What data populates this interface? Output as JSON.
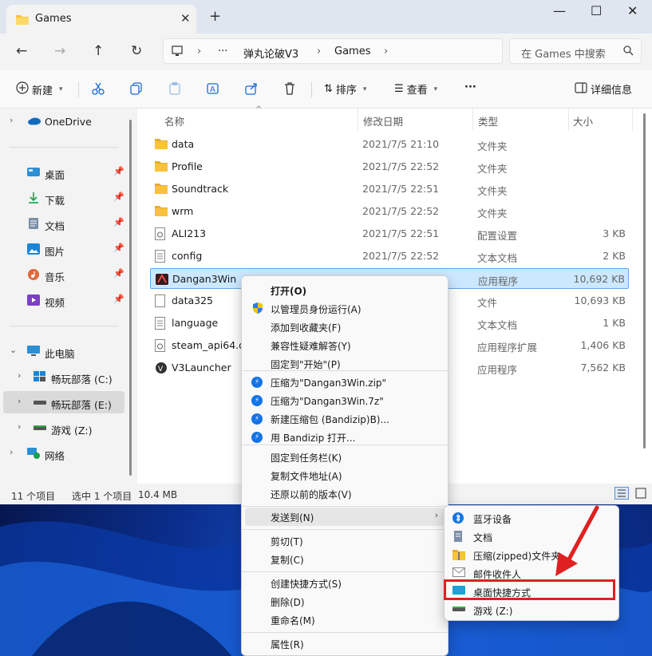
{
  "window": {
    "tab_title": "Games",
    "tab_close": "✕",
    "new_tab": "+",
    "minimize": "—",
    "maximize": "☐",
    "close": "✕"
  },
  "address": {
    "more": "···",
    "crumbs": [
      "弹丸论破V3",
      "Games"
    ],
    "search_placeholder": "在 Games 中搜索"
  },
  "toolbar": {
    "new_label": "新建",
    "sort_label": "排序",
    "view_label": "查看",
    "more_label": "···",
    "details_label": "详细信息"
  },
  "sidebar": {
    "onedrive": "OneDrive",
    "quick": [
      {
        "label": "桌面",
        "icon": "desktop-icon"
      },
      {
        "label": "下载",
        "icon": "download-icon"
      },
      {
        "label": "文档",
        "icon": "document-icon"
      },
      {
        "label": "图片",
        "icon": "pictures-icon"
      },
      {
        "label": "音乐",
        "icon": "music-icon"
      },
      {
        "label": "视频",
        "icon": "video-icon"
      }
    ],
    "this_pc": "此电脑",
    "drives": [
      {
        "label": "畅玩部落 (C:)"
      },
      {
        "label": "畅玩部落 (E:)"
      },
      {
        "label": "游戏 (Z:)"
      }
    ],
    "network": "网络"
  },
  "columns": {
    "name": "名称",
    "date": "修改日期",
    "type": "类型",
    "size": "大小"
  },
  "files": [
    {
      "name": "data",
      "date": "2021/7/5 21:10",
      "type": "文件夹",
      "size": "",
      "icon": "folder"
    },
    {
      "name": "Profile",
      "date": "2021/7/5 22:52",
      "type": "文件夹",
      "size": "",
      "icon": "folder"
    },
    {
      "name": "Soundtrack",
      "date": "2021/7/5 22:51",
      "type": "文件夹",
      "size": "",
      "icon": "folder"
    },
    {
      "name": "wrm",
      "date": "2021/7/5 22:52",
      "type": "文件夹",
      "size": "",
      "icon": "folder"
    },
    {
      "name": "ALI213",
      "date": "2021/7/5 22:51",
      "type": "配置设置",
      "size": "3 KB",
      "icon": "settings-file"
    },
    {
      "name": "config",
      "date": "2021/7/5 22:52",
      "type": "文本文档",
      "size": "2 KB",
      "icon": "text-file"
    },
    {
      "name": "Dangan3Win",
      "date": "2021/7/5 22:52",
      "type": "应用程序",
      "size": "10,692 KB",
      "icon": "app"
    },
    {
      "name": "data325",
      "date": "",
      "type": "文件",
      "size": "10,693 KB",
      "icon": "file"
    },
    {
      "name": "language",
      "date": "",
      "type": "文本文档",
      "size": "1 KB",
      "icon": "text-file"
    },
    {
      "name": "steam_api64.dll",
      "date": "",
      "type": "应用程序扩展",
      "size": "1,406 KB",
      "icon": "dll"
    },
    {
      "name": "V3Launcher",
      "date": "",
      "type": "应用程序",
      "size": "7,562 KB",
      "icon": "launcher"
    }
  ],
  "status": {
    "count": "11 个项目",
    "selected": "选中 1 个项目",
    "size": "10.4 MB"
  },
  "context_menu": {
    "items": [
      {
        "label": "打开(O)",
        "bold": true,
        "icon": ""
      },
      {
        "label": "以管理员身份运行(A)",
        "icon": "shield-icon"
      },
      {
        "label": "添加到收藏夹(F)",
        "icon": ""
      },
      {
        "label": "兼容性疑难解答(Y)",
        "icon": ""
      },
      {
        "label": "固定到\"开始\"(P)",
        "icon": ""
      },
      {
        "label": "压缩为\"Dangan3Win.zip\"",
        "icon": "bandizip-icon"
      },
      {
        "label": "压缩为\"Dangan3Win.7z\"",
        "icon": "bandizip-icon"
      },
      {
        "label": "新建压缩包 (Bandizip)B)...",
        "icon": "bandizip-icon"
      },
      {
        "label": "用 Bandizip 打开...",
        "icon": "bandizip-icon"
      },
      {
        "label": "固定到任务栏(K)",
        "icon": ""
      },
      {
        "label": "复制文件地址(A)",
        "icon": ""
      },
      {
        "label": "还原以前的版本(V)",
        "icon": ""
      }
    ],
    "send_to": "发送到(N)",
    "edit": [
      {
        "label": "剪切(T)"
      },
      {
        "label": "复制(C)"
      }
    ],
    "manage": [
      {
        "label": "创建快捷方式(S)"
      },
      {
        "label": "删除(D)"
      },
      {
        "label": "重命名(M)"
      }
    ],
    "properties": "属性(R)"
  },
  "send_to_menu": [
    {
      "label": "蓝牙设备",
      "icon": "bluetooth-icon"
    },
    {
      "label": "文档",
      "icon": "document-icon"
    },
    {
      "label": "压缩(zipped)文件夹",
      "icon": "zip-folder-icon"
    },
    {
      "label": "邮件收件人",
      "icon": "mail-icon"
    },
    {
      "label": "桌面快捷方式",
      "icon": "desktop-icon"
    },
    {
      "label": "游戏 (Z:)",
      "icon": "drive-icon"
    }
  ],
  "colors": {
    "accent": "#0067c0",
    "selection": "#cce8ff",
    "highlight_box": "#e02020",
    "arrow": "#e02020",
    "folder": "#f8c33a"
  }
}
